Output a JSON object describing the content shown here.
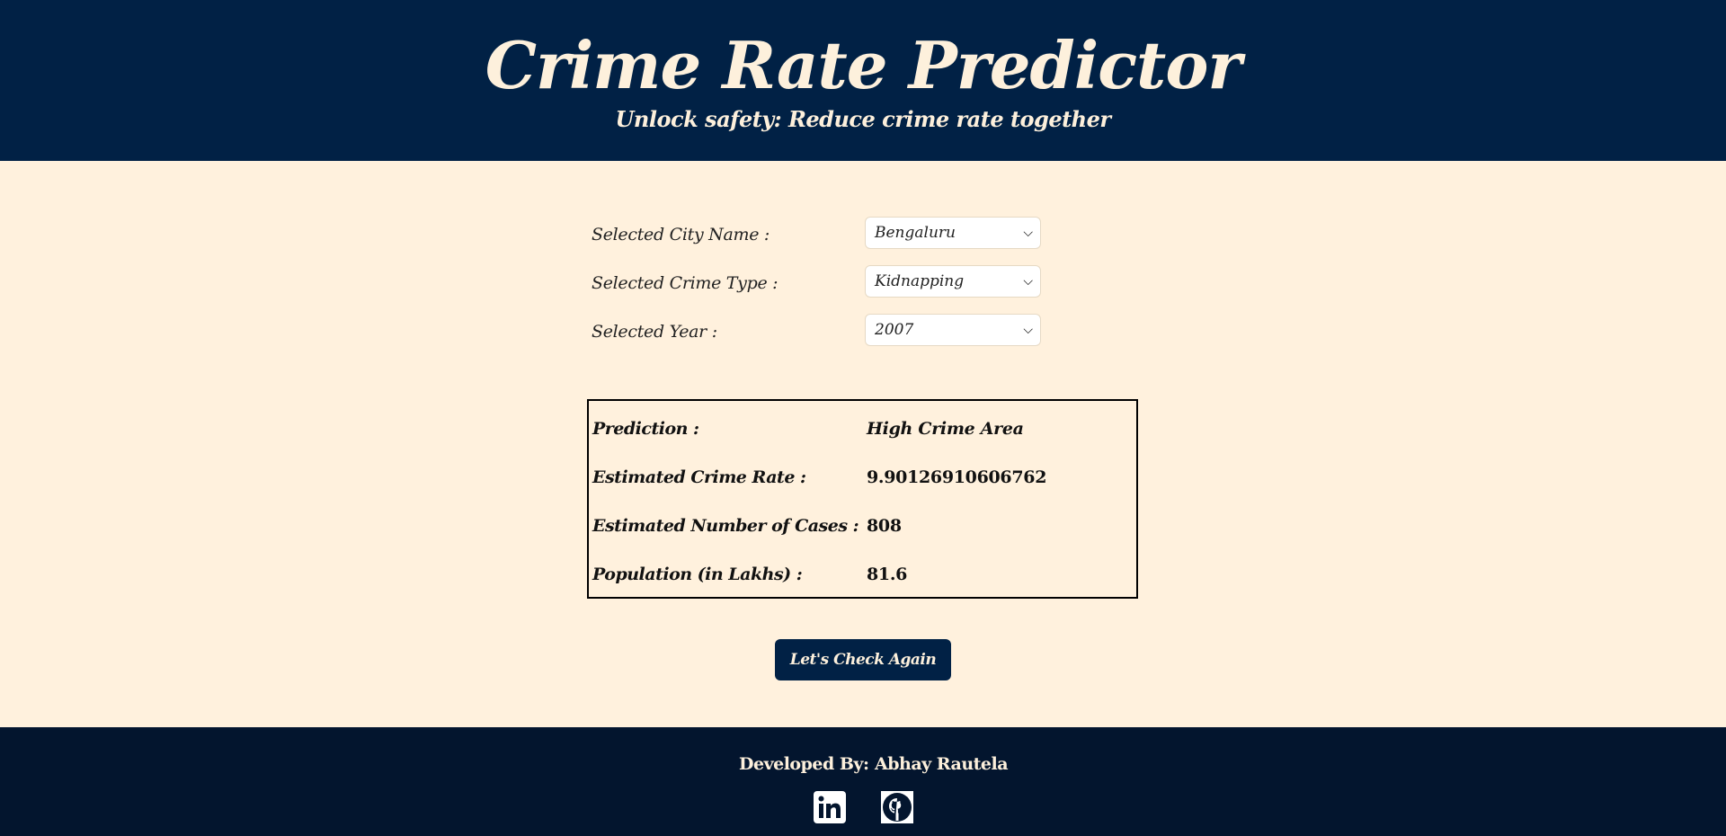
{
  "header": {
    "title": "Crime Rate Predictor",
    "subtitle": "Unlock safety: Reduce crime rate together"
  },
  "form": {
    "city": {
      "label": "Selected City Name :",
      "value": "Bengaluru"
    },
    "crime_type": {
      "label": "Selected Crime Type :",
      "value": "Kidnapping"
    },
    "year": {
      "label": "Selected Year :",
      "value": "2007"
    }
  },
  "result": {
    "prediction": {
      "label": "Prediction :",
      "value": "High Crime Area"
    },
    "crime_rate": {
      "label": "Estimated Crime Rate :",
      "value": "9.90126910606762"
    },
    "cases": {
      "label": "Estimated Number of Cases :",
      "value": "808"
    },
    "population": {
      "label": "Population (in Lakhs) :",
      "value": "81.6"
    }
  },
  "check_again_label": "Let's Check Again",
  "footer": {
    "developed_by_label": "Developed By:",
    "developer_name": "Abhay Rautela",
    "icons": [
      "linkedin-icon",
      "github-icon"
    ]
  },
  "colors": {
    "header_bg": "#012145",
    "page_bg": "#fff1dd",
    "footer_bg": "#03152e",
    "accent_text": "#fdf0dc"
  }
}
